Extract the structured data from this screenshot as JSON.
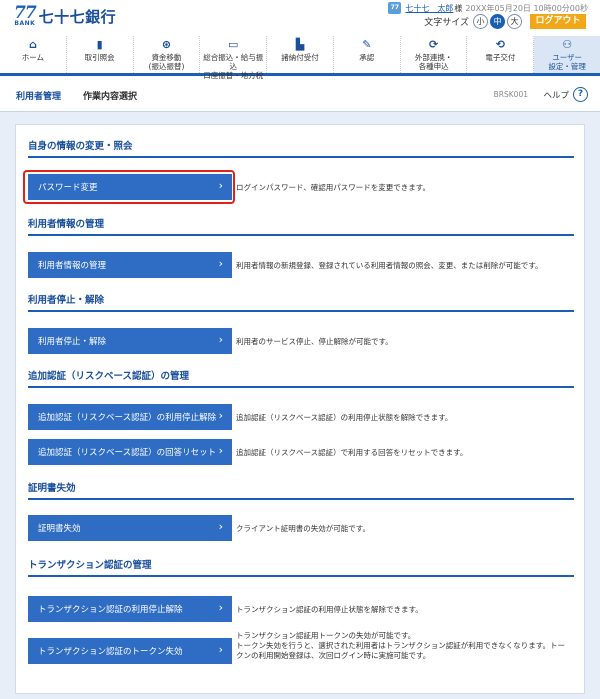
{
  "bank": {
    "mark": "77",
    "mark_sub": "BANK",
    "name": "七十七銀行"
  },
  "user": {
    "icon": "user-icon",
    "name": "七十七　太郎",
    "honorific": "様",
    "datetime": "20XX年05月20日 10時00分00秒"
  },
  "font_size": {
    "label": "文字サイズ",
    "small": "小",
    "medium": "中",
    "large": "大",
    "selected": "中"
  },
  "logout": {
    "label": "ログアウト"
  },
  "nav": [
    {
      "icon": "home-icon",
      "label": "ホーム"
    },
    {
      "icon": "document-icon",
      "label": "取引照会"
    },
    {
      "icon": "transfer-icon",
      "label": "資金移動\n(振込振替)"
    },
    {
      "icon": "bulk-transfer-icon",
      "label": "総合振込・給与振込\n口座振替・地方税"
    },
    {
      "icon": "payment-icon",
      "label": "諸納付受付"
    },
    {
      "icon": "approval-icon",
      "label": "承認"
    },
    {
      "icon": "link-icon",
      "label": "外部連携・\n各種申込"
    },
    {
      "icon": "e-delivery-icon",
      "label": "電子交付"
    },
    {
      "icon": "user-settings-icon",
      "label": "ユーザー\n設定・管理"
    }
  ],
  "breadcrumb": {
    "section": "利用者管理",
    "page": "作業内容選択"
  },
  "screen_id": "BRSK001",
  "help": {
    "label": "ヘルプ",
    "icon_char": "?"
  },
  "sections": [
    {
      "title": "自身の情報の変更・照会",
      "actions": [
        {
          "label": "パスワード変更",
          "description": "ログインパスワード、確認用パスワードを変更できます。"
        }
      ]
    },
    {
      "title": "利用者情報の管理",
      "actions": [
        {
          "label": "利用者情報の管理",
          "description": "利用者情報の新規登録、登録されている利用者情報の照会、変更、または削除が可能です。"
        }
      ]
    },
    {
      "title": "利用者停止・解除",
      "actions": [
        {
          "label": "利用者停止・解除",
          "description": "利用者のサービス停止、停止解除が可能です。"
        }
      ]
    },
    {
      "title": "追加認証（リスクベース認証）の管理",
      "actions": [
        {
          "label": "追加認証（リスクベース認証）の利用停止解除",
          "description": "追加認証（リスクベース認証）の利用停止状態を解除できます。"
        },
        {
          "label": "追加認証（リスクベース認証）の回答リセット",
          "description": "追加認証（リスクベース認証）で利用する回答をリセットできます。"
        }
      ]
    },
    {
      "title": "証明書失効",
      "actions": [
        {
          "label": "証明書失効",
          "description": "クライアント証明書の失効が可能です。"
        }
      ]
    },
    {
      "title": "トランザクション認証の管理",
      "actions": [
        {
          "label": "トランザクション認証の利用停止解除",
          "description": "トランザクション認証の利用停止状態を解除できます。"
        },
        {
          "label": "トランザクション認証のトークン失効",
          "description": "トランザクション認証用トークンの失効が可能です。",
          "description_2": "トークン失効を行うと、選択された利用者はトランザクション認証が利用できなくなります。トークンの利用開始登録は、次回ログイン時に実施可能です。"
        }
      ]
    }
  ],
  "chevron": "›",
  "colors": {
    "primary": "#2f6cc3",
    "accent": "#f0a818",
    "highlight": "#e0221a",
    "background": "#e8eef7"
  }
}
